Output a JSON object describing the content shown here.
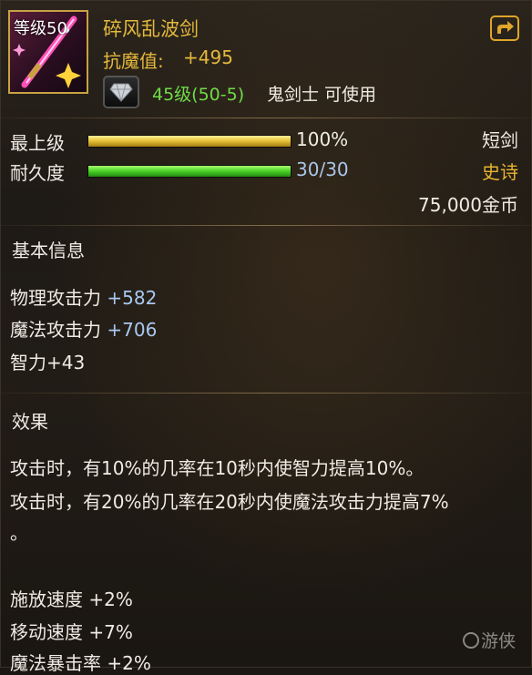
{
  "item": {
    "level_tag": "等级50",
    "name": "碎风乱波剑",
    "resist_label": "抗魔值:",
    "resist_value": "+495",
    "requirement_level": "45级(50-5)",
    "requirement_class": "鬼剑士 可使用",
    "icon": "sword-icon",
    "gem_icon": "diamond-icon",
    "share_icon": "share-arrow-icon"
  },
  "bars": {
    "grade_label": "最上级",
    "grade_value": "100%",
    "grade_fraction": 1.0,
    "durability_label": "耐久度",
    "durability_value": "30/30",
    "durability_fraction": 1.0
  },
  "meta": {
    "weapon_type": "短剑",
    "rarity": "史诗",
    "price": "75,000金币"
  },
  "basic_info": {
    "title": "基本信息",
    "stats": [
      {
        "name": "物理攻击力",
        "value": "+582"
      },
      {
        "name": "魔法攻击力",
        "value": "+706"
      },
      {
        "name": "智力",
        "value": "+43"
      }
    ]
  },
  "effects": {
    "title": "效果",
    "lines": [
      "攻击时，有10%的几率在10秒内使智力提高10%。",
      "攻击时，有20%的几率在20秒内使魔法攻击力提高7%",
      "。",
      "施放速度 +2%",
      "移动速度 +7%",
      "魔法暴击率 +2%"
    ]
  },
  "watermark": "游侠",
  "colors": {
    "item_name": "#e4b83c",
    "requirement_level": "#6fdc46",
    "rarity": "#e8b330",
    "stat_plus": "#a8c8f0",
    "durability_value": "#a9c6e8"
  }
}
